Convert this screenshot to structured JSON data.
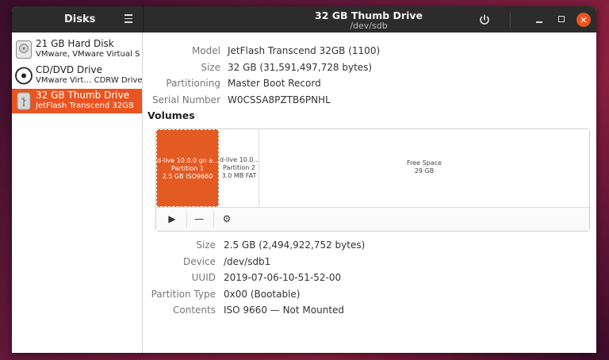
{
  "app": {
    "title": "Disks"
  },
  "window": {
    "title": "32 GB Thumb Drive",
    "subtitle": "/dev/sdb"
  },
  "sidebar": {
    "items": [
      {
        "name": "21 GB Hard Disk",
        "sub": "VMware, VMware Virtual S",
        "icon": "hard-disk-icon",
        "selected": false
      },
      {
        "name": "CD/DVD Drive",
        "sub": "VMware Virt… CDRW Drive",
        "icon": "optical-drive-icon",
        "selected": false
      },
      {
        "name": "32 GB Thumb Drive",
        "sub": "JetFlash Transcend 32GB",
        "icon": "usb-drive-icon",
        "selected": true
      }
    ]
  },
  "drive": {
    "model_label": "Model",
    "model": "JetFlash Transcend 32GB (1100)",
    "size_label": "Size",
    "size": "32 GB (31,591,497,728 bytes)",
    "partitioning_label": "Partitioning",
    "partitioning": "Master Boot Record",
    "serial_label": "Serial Number",
    "serial": "W0CSSA8PZTB6PNHL"
  },
  "volumes": {
    "title": "Volumes",
    "segments": [
      {
        "line1": "d-live 10.0.0 gn a…",
        "line2": "Partition 1",
        "line3": "2.5 GB ISO9660"
      },
      {
        "line1": "d-live 10.0…",
        "line2": "Partition 2",
        "line3": "3.0 MB FAT"
      },
      {
        "line1": "Free Space",
        "line2": "29 GB"
      }
    ],
    "toolbar": {
      "play": "▶",
      "minus": "—",
      "settings": "⚙"
    }
  },
  "partition": {
    "size_label": "Size",
    "size": "2.5 GB (2,494,922,752 bytes)",
    "device_label": "Device",
    "device": "/dev/sdb1",
    "uuid_label": "UUID",
    "uuid": "2019-07-06-10-51-52-00",
    "type_label": "Partition Type",
    "type": "0x00 (Bootable)",
    "contents_label": "Contents",
    "contents": "ISO 9660 — Not Mounted"
  },
  "colors": {
    "accent": "#e95420",
    "titlebar": "#2c2c2c"
  }
}
